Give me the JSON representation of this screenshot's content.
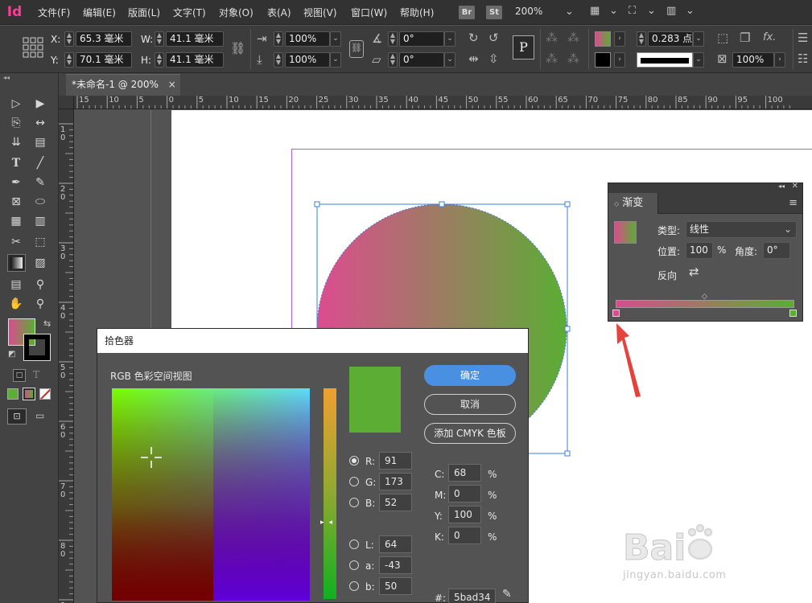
{
  "app": {
    "logo": "Id"
  },
  "menu": [
    "文件(F)",
    "编辑(E)",
    "版面(L)",
    "文字(T)",
    "对象(O)",
    "表(A)",
    "视图(V)",
    "窗口(W)",
    "帮助(H)"
  ],
  "menu_right": {
    "br": "Br",
    "st": "St",
    "zoom": "200%"
  },
  "control": {
    "x_label": "X:",
    "x_value": "65.3 毫米",
    "y_label": "Y:",
    "y_value": "70.1 毫米",
    "w_label": "W:",
    "w_value": "41.1 毫米",
    "h_label": "H:",
    "h_value": "41.1 毫米",
    "scale_x": "100%",
    "scale_y": "100%",
    "rotate": "0°",
    "shear": "0°",
    "stroke_weight": "0.283 点",
    "opacity": "100%",
    "p_label": "P"
  },
  "tab": {
    "title": "*未命名-1 @ 200%",
    "close": "×"
  },
  "ruler": {
    "h_labels": [
      "15",
      "10",
      "5",
      "0",
      "5",
      "10",
      "15",
      "20",
      "25",
      "30",
      "35",
      "40",
      "45",
      "50",
      "55",
      "60",
      "65",
      "70",
      "75",
      "80",
      "85",
      "90",
      "95",
      "100"
    ],
    "v_labels": [
      "1",
      "2",
      "3",
      "4",
      "5",
      "6",
      "7",
      "8",
      "9"
    ]
  },
  "gradient_panel": {
    "title": "渐变",
    "type_label": "类型:",
    "type_value": "线性",
    "position_label": "位置:",
    "position_value": "100",
    "position_unit": "%",
    "angle_label": "角度:",
    "angle_value": "0°",
    "reverse_label": "反向",
    "start_color": "#d94c8e",
    "end_color": "#5bad34"
  },
  "color_picker": {
    "title": "拾色器",
    "space_label": "RGB 色彩空间视图",
    "ok": "确定",
    "cancel": "取消",
    "add_cmyk": "添加 CMYK 色板",
    "R": "91",
    "G": "173",
    "B": "52",
    "L": "64",
    "a": "-43",
    "b": "50",
    "C": "68",
    "M": "0",
    "Y": "100",
    "K": "0",
    "percent": "%",
    "hex_label": "#:",
    "hex": "5bad34",
    "labels": {
      "R": "R:",
      "G": "G:",
      "B": "B:",
      "L": "L:",
      "a": "a:",
      "b": "b:",
      "C": "C:",
      "M": "M:",
      "Y": "Y:",
      "K": "K:"
    }
  },
  "watermark": {
    "text": "jingyan.baidu.com"
  },
  "colors": {
    "accent": "#4a90e2",
    "selection": "#3e7dd8",
    "magenta": "#d94c8e",
    "green": "#5bad34"
  }
}
